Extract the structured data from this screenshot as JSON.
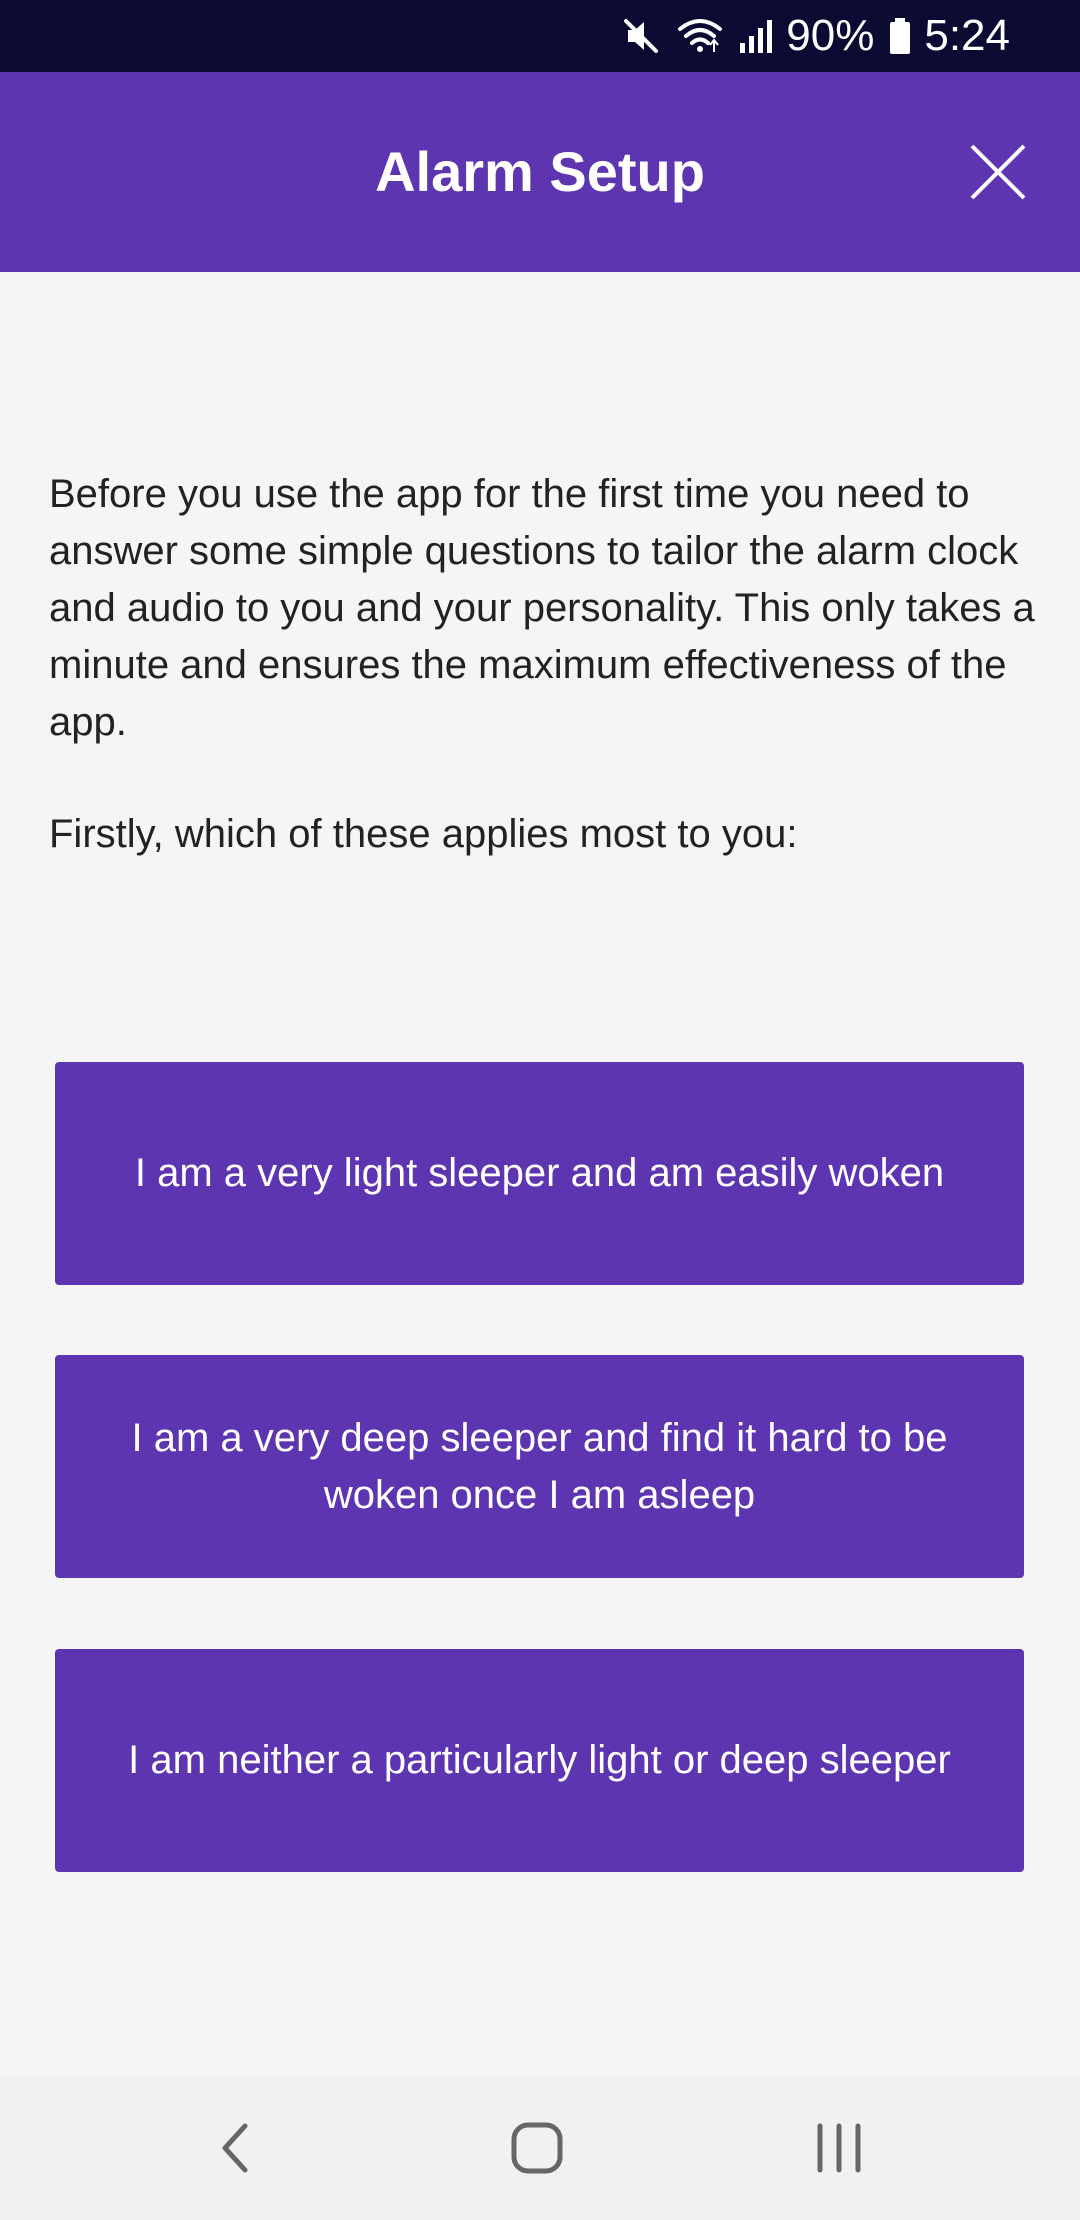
{
  "status_bar": {
    "battery_percent": "90%",
    "time": "5:24",
    "icons": [
      "mute-icon",
      "wifi-icon",
      "signal-icon",
      "battery-icon"
    ]
  },
  "app_bar": {
    "title": "Alarm Setup",
    "close_icon": "close-icon"
  },
  "content": {
    "intro": "Before you use the app for the first time you need to answer some simple questions to tailor the alarm clock and audio to you and your personality. This only takes a minute and ensures the maximum effectiveness of the app.",
    "question": "Firstly, which of these applies most to you:",
    "options": [
      "I am a very light sleeper and am easily woken",
      "I am a very deep sleeper and find it hard to be woken once I am asleep",
      "I am neither a particularly light or deep sleeper"
    ]
  },
  "nav_bar": {
    "icons": [
      "back-icon",
      "home-icon",
      "recents-icon"
    ]
  },
  "colors": {
    "accent": "#5e35b1",
    "status_bar": "#0a0a33",
    "background": "#f5f5f5",
    "text": "#222222"
  }
}
